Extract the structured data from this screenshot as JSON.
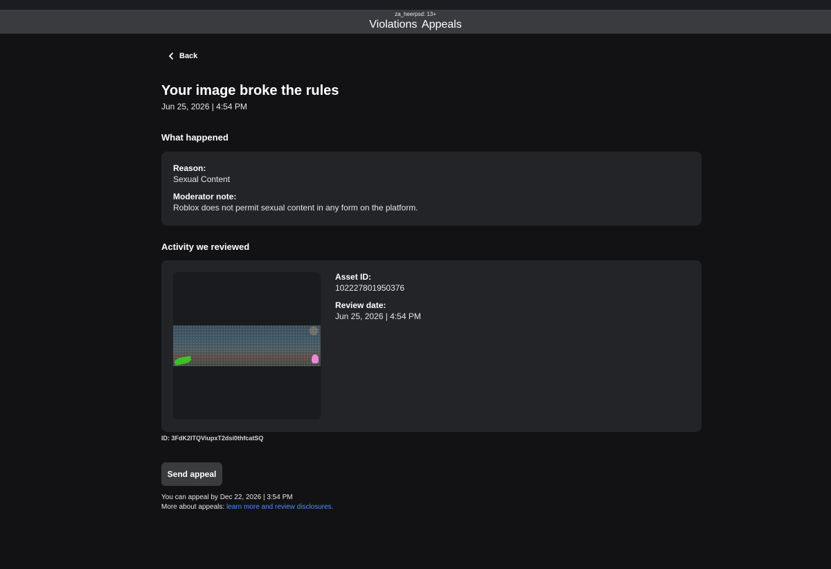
{
  "header": {
    "user_label": "za_heerpsd: 13+",
    "title": "Violations  Appeals"
  },
  "nav": {
    "back_label": "Back"
  },
  "page": {
    "title": "Your image broke the rules",
    "date": "Jun 25, 2026 | 4:54 PM"
  },
  "what_happened": {
    "section_title": "What happened",
    "reason_label": "Reason:",
    "reason_value": "Sexual Content",
    "note_label": "Moderator note:",
    "note_value": "Roblox does not permit sexual content in any form on the platform."
  },
  "activity": {
    "section_title": "Activity we reviewed",
    "asset_id_label": "Asset ID:",
    "asset_id_value": "102227801950376",
    "review_date_label": "Review date:",
    "review_date_value": "Jun 25, 2026 | 4:54 PM"
  },
  "footer": {
    "id_text": "ID: 3FdK2lTQViupxT2dsi0thfcatSQ",
    "appeal_button": "Send appeal",
    "deadline_text": "You can appeal by Dec 22, 2026 | 3:54 PM",
    "more_prefix": "More about appeals: ",
    "more_link": "learn more and review disclosures."
  },
  "colors": {
    "background": "#121215",
    "card": "#232428",
    "button": "#393b3d",
    "link": "#4f8cff"
  }
}
